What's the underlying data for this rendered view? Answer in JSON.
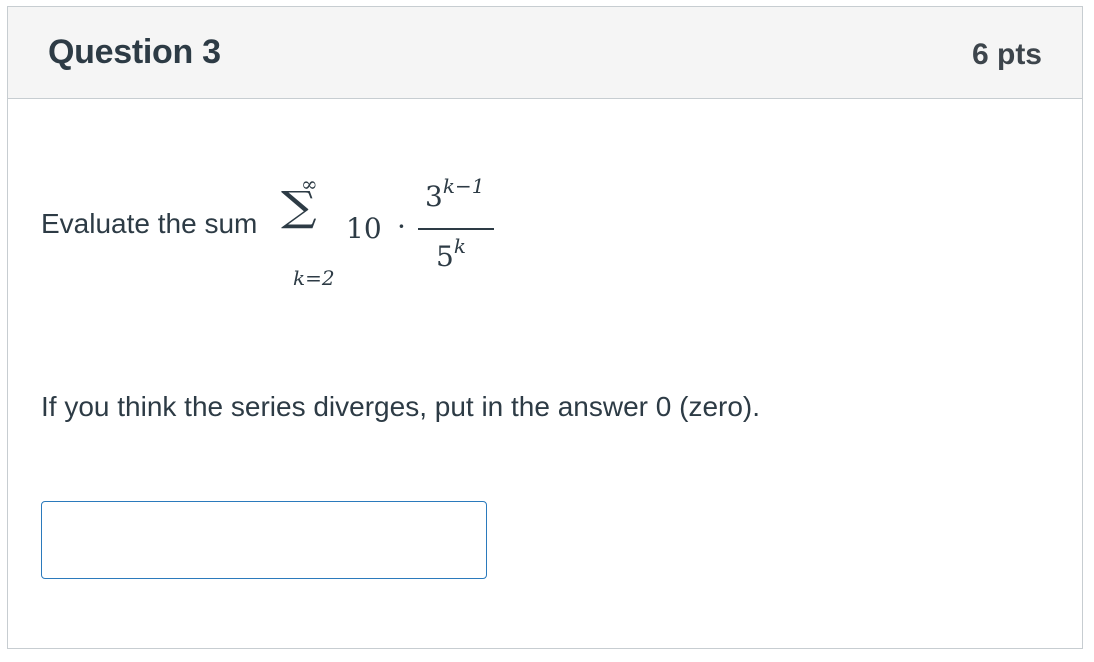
{
  "question": {
    "title": "Question 3",
    "points": "6 pts"
  },
  "prompt": {
    "text": "Evaluate the sum",
    "math": {
      "upper_limit": "∞",
      "sigma": "∑",
      "lower_limit": "k=2",
      "coefficient": "10",
      "operator": "·",
      "numerator_base": "3",
      "numerator_exponent": "k−1",
      "denominator_base": "5",
      "denominator_exponent": "k"
    }
  },
  "instruction": "If you think the series diverges, put in the answer 0 (zero).",
  "answer": {
    "value": "",
    "accent_color": "#2b7abc"
  }
}
